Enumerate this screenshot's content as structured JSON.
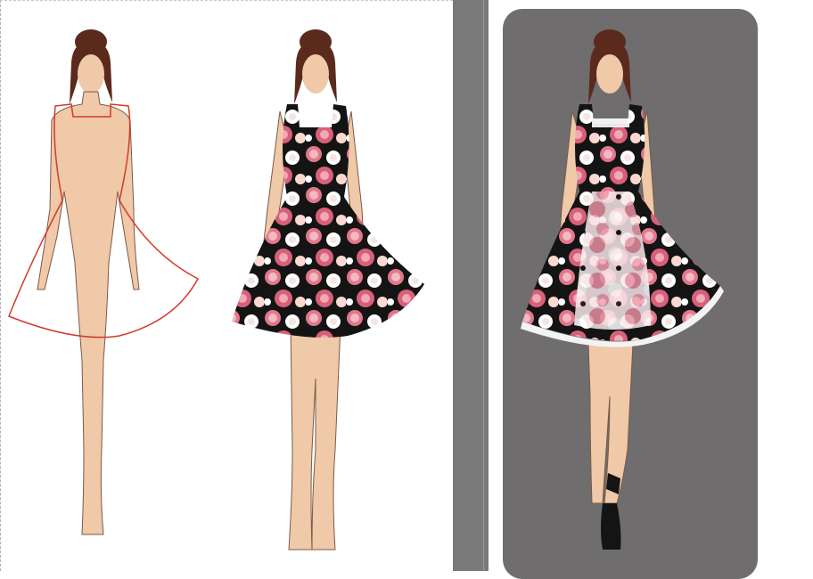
{
  "panels": [
    {
      "id": "body-outline"
    },
    {
      "id": "floral-dress"
    },
    {
      "id": "lace-dress"
    }
  ],
  "colors": {
    "skin": "#efc9a8",
    "hair": "#5a2a1c",
    "outline": "#d33a2c",
    "dress_black": "#141414",
    "rose": "#e2778b",
    "rose_light": "#f4b9c2",
    "white": "#ffffff",
    "card": "#6f6d6e",
    "divider": "#7a7a7a"
  }
}
